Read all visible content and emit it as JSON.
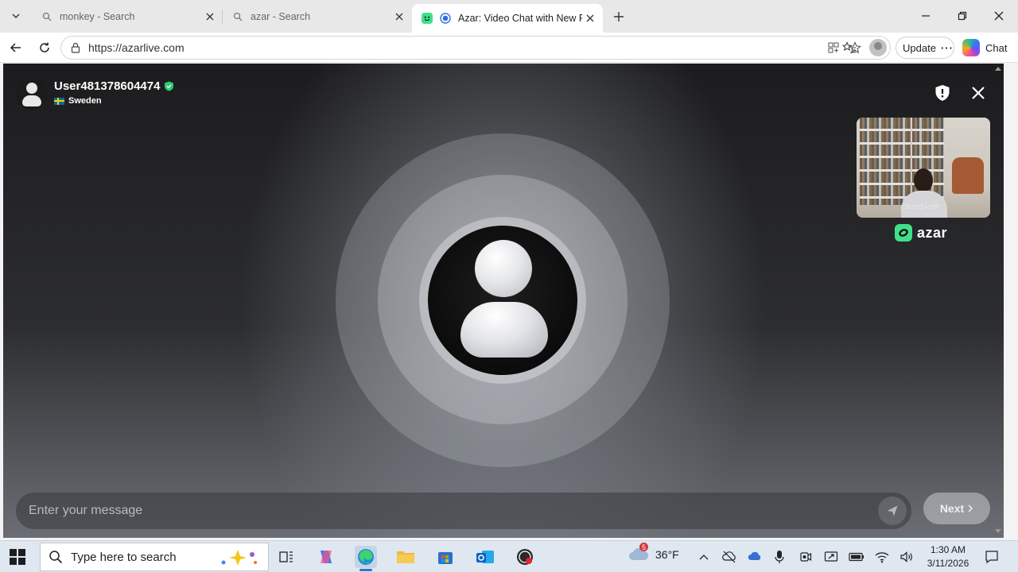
{
  "browser": {
    "tabs": [
      {
        "title": "monkey - Search",
        "active": false
      },
      {
        "title": "azar - Search",
        "active": false
      },
      {
        "title": "Azar: Video Chat with New Pe",
        "active": true
      }
    ],
    "url": "https://azarlive.com",
    "update_label": "Update",
    "chat_label": "Chat"
  },
  "page": {
    "user": {
      "username": "User481378604474",
      "country": "Sweden"
    },
    "self_video_caption": "c5czrS+rdT",
    "brand": "azar",
    "message_placeholder": "Enter your message",
    "next_label": "Next",
    "colors": {
      "brand_green": "#3fe08a",
      "verified_green": "#2ecc71"
    }
  },
  "taskbar": {
    "search_placeholder": "Type here to search",
    "weather_temp": "36°F",
    "weather_badge": "5",
    "time": "1:30 AM",
    "date": "3/11/2026"
  }
}
